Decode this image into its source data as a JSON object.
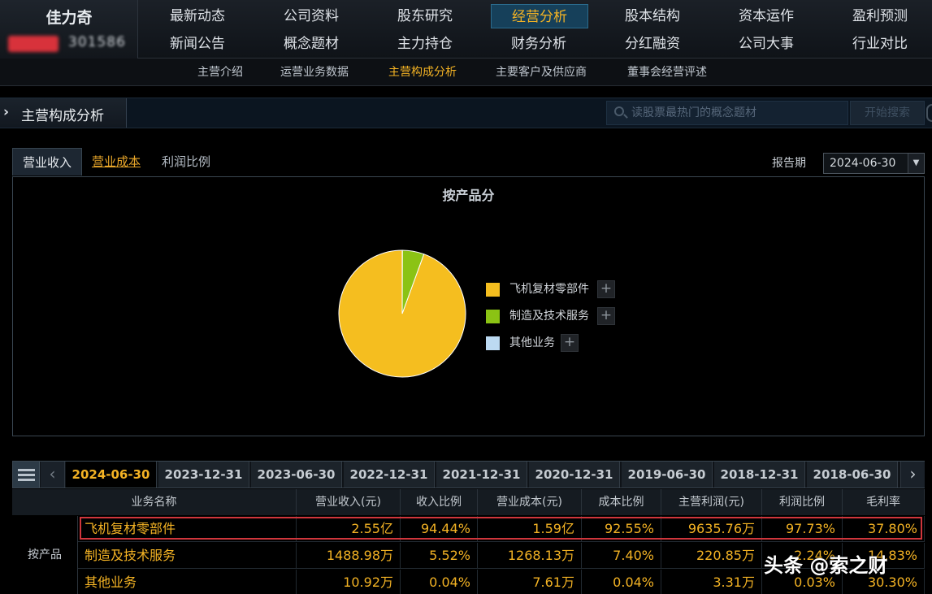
{
  "stock": {
    "name": "佳力奇",
    "code": "301586"
  },
  "nav": {
    "row1": [
      "最新动态",
      "公司资料",
      "股东研究",
      "经营分析",
      "股本结构",
      "资本运作",
      "盈利预测"
    ],
    "row2": [
      "新闻公告",
      "概念题材",
      "主力持仓",
      "财务分析",
      "分红融资",
      "公司大事",
      "行业对比"
    ],
    "active": "经营分析"
  },
  "subnav": {
    "items": [
      "主营介绍",
      "运营业务数据",
      "主营构成分析",
      "主要客户及供应商",
      "董事会经营评述"
    ],
    "active": "主营构成分析"
  },
  "section": {
    "title": "主营构成分析",
    "search_placeholder": "读股票最热门的概念题材",
    "search_button": "开始搜索"
  },
  "tabs": {
    "items": [
      "营业收入",
      "营业成本",
      "利润比例"
    ],
    "active": "营业收入"
  },
  "report_period": {
    "label": "报告期",
    "value": "2024-06-30"
  },
  "chart_data": {
    "type": "pie",
    "title": "按产品分",
    "slices": [
      {
        "label": "飞机复材零部件",
        "value": 94.44,
        "color": "#f5be1f"
      },
      {
        "label": "制造及技术服务",
        "value": 5.52,
        "color": "#8bc314"
      },
      {
        "label": "其他业务",
        "value": 0.04,
        "color": "#bcdaf2"
      }
    ]
  },
  "legend_plus": "+",
  "dates": [
    "2024-06-30",
    "2023-12-31",
    "2023-06-30",
    "2022-12-31",
    "2021-12-31",
    "2020-12-31",
    "2019-06-30",
    "2018-12-31",
    "2018-06-30"
  ],
  "date_active": "2024-06-30",
  "table": {
    "headers": [
      "业务名称",
      "营业收入(元)",
      "收入比例",
      "营业成本(元)",
      "成本比例",
      "主营利润(元)",
      "利润比例",
      "毛利率"
    ],
    "group": "按产品",
    "rows": [
      [
        "飞机复材零部件",
        "2.55亿",
        "94.44%",
        "1.59亿",
        "92.55%",
        "9635.76万",
        "97.73%",
        "37.80%"
      ],
      [
        "制造及技术服务",
        "1488.98万",
        "5.52%",
        "1268.13万",
        "7.40%",
        "220.85万",
        "2.24%",
        "14.83%"
      ],
      [
        "其他业务",
        "10.92万",
        "0.04%",
        "7.61万",
        "0.04%",
        "3.31万",
        "0.03%",
        "30.30%"
      ]
    ]
  },
  "watermark": "头条 @索之财"
}
